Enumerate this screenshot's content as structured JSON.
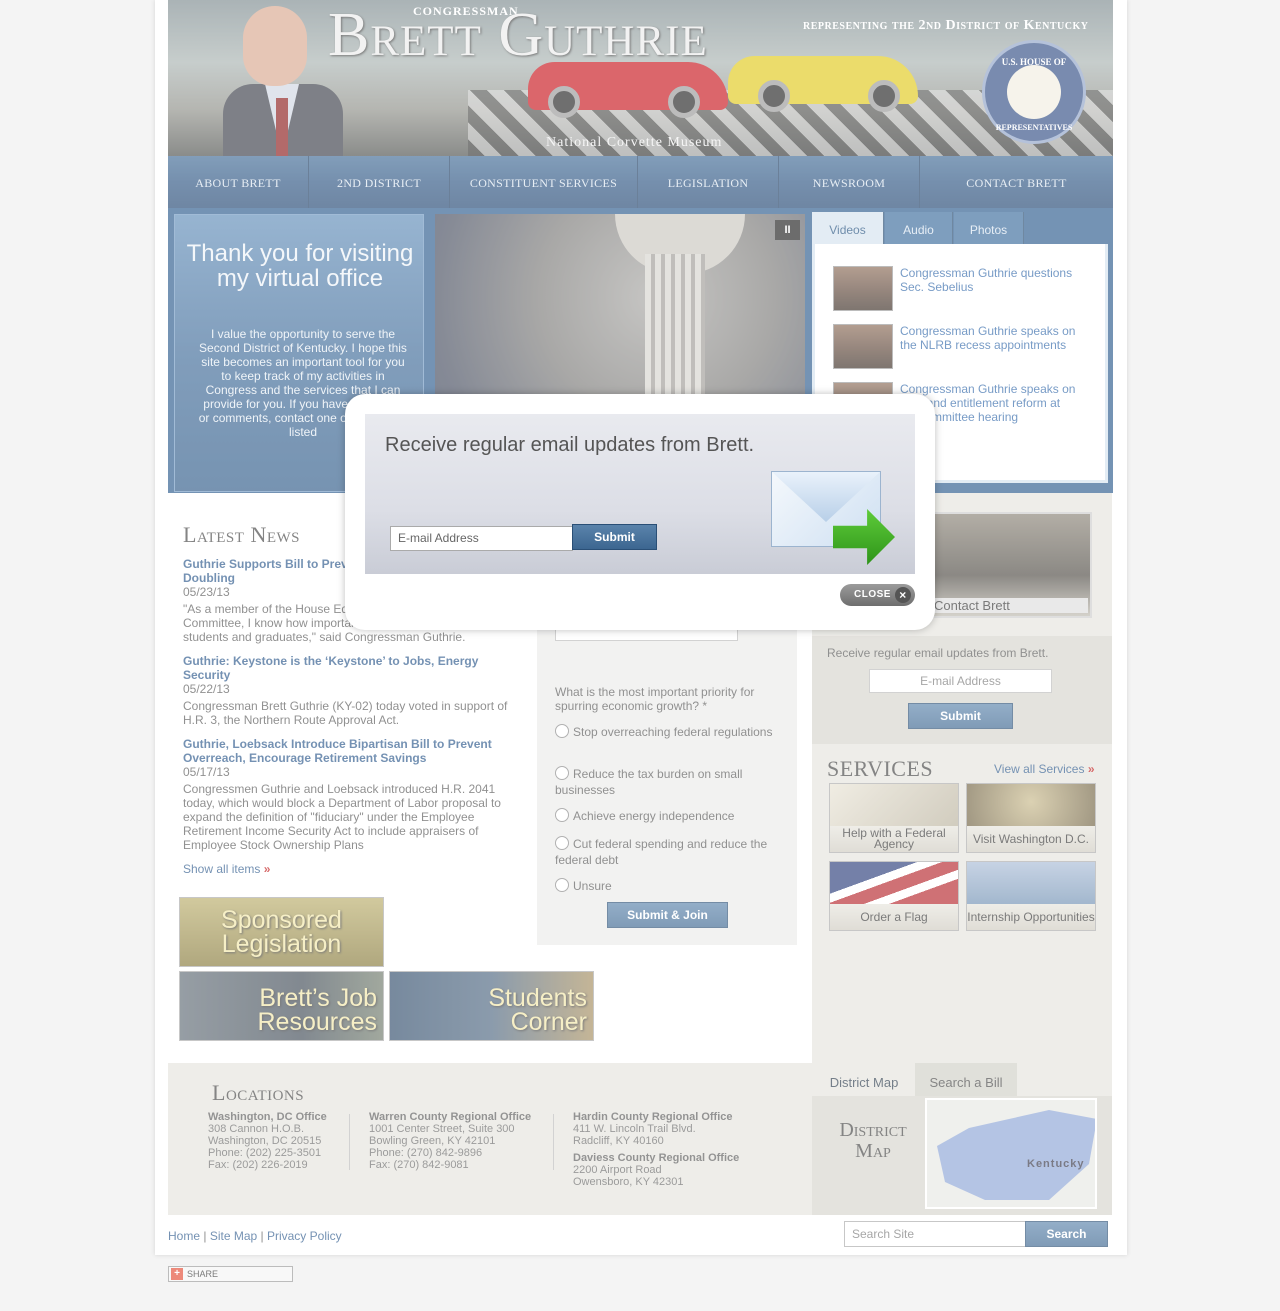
{
  "header": {
    "congressman": "CONGRESSMAN",
    "name": "Brett Guthrie",
    "representing": "representing the 2nd District of Kentucky",
    "caption": "National Corvette Museum",
    "seal_top": "U.S. HOUSE OF",
    "seal_bottom": "REPRESENTATIVES"
  },
  "nav": {
    "items": [
      "ABOUT BRETT",
      "2ND DISTRICT",
      "CONSTITUENT SERVICES",
      "LEGISLATION",
      "NEWSROOM",
      "CONTACT BRETT"
    ]
  },
  "welcome": {
    "title": "Thank you for visiting my virtual office",
    "body": "I value the opportunity to serve the Second District of Kentucky. I hope this site becomes an important tool for you to keep track of my activities in Congress and the services that I can provide for you. If you have questions or comments, contact one of my offices listed"
  },
  "slideshow": {
    "pause_label": "II"
  },
  "media": {
    "tabs": [
      "Videos",
      "Audio",
      "Photos"
    ],
    "videos": [
      "Congressman Guthrie questions Sec. Sebelius",
      "Congressman Guthrie speaks on the NLRB recess appointments",
      "Congressman Guthrie speaks on debt and entitlement reform at subcommittee hearing"
    ]
  },
  "news": {
    "title": "Latest News",
    "items": [
      {
        "title": "Guthrie Supports Bill to Prevent Student Loan Rate Doubling",
        "date": "05/23/13",
        "excerpt": "\"As a member of the House Education and the Workforce Committee, I know how important it is to protect our nation's students and graduates,\" said Congressman Guthrie."
      },
      {
        "title": "Guthrie: Keystone is the ‘Keystone’ to Jobs, Energy Security",
        "date": "05/22/13",
        "excerpt": "Congressman Brett Guthrie (KY-02) today voted in support of H.R. 3, the Northern Route Approval Act."
      },
      {
        "title": "Guthrie, Loebsack Introduce Bipartisan Bill to Prevent Overreach, Encourage Retirement Savings",
        "date": "05/17/13",
        "excerpt": "Congressmen Guthrie and Loebsack introduced H.R. 2041 today, which would block a Department of Labor proposal to expand the definition of \"fiduciary\" under the Employee Retirement Income Security Act to include appraisers of Employee Stock Ownership Plans"
      }
    ],
    "show_all": "Show all items",
    "show_all_arrow": "»"
  },
  "promos": {
    "sponsored": "Sponsored Legislation",
    "jobs": "Brett’s Job Resources",
    "students": "Students Corner"
  },
  "poll": {
    "question": "What is the most important priority for spurring economic growth? *",
    "options": [
      "Stop overreaching federal regulations",
      "Reduce the tax burden on small businesses",
      "Achieve energy independence",
      "Cut federal spending and reduce the federal debt",
      "Unsure"
    ],
    "submit": "Submit & Join"
  },
  "contact_card": {
    "label": "Contact Brett"
  },
  "email_signup": {
    "text": "Receive regular email updates from Brett.",
    "placeholder": "E-mail Address",
    "submit": "Submit"
  },
  "services": {
    "title": "SERVICES",
    "view_all": "View all Services",
    "view_all_arrow": "»",
    "items": [
      "Help with a Federal Agency",
      "Visit Washington D.C.",
      "Order a Flag",
      "Internship Opportunities"
    ]
  },
  "locations": {
    "title": "Locations",
    "offices": [
      {
        "name": "Washington, DC Office",
        "lines": [
          "308 Cannon H.O.B.",
          "Washington, DC 20515",
          "Phone: (202) 225-3501",
          "Fax: (202) 226-2019"
        ]
      },
      {
        "name": "Warren County Regional Office",
        "lines": [
          "1001 Center Street, Suite 300",
          "Bowling Green, KY 42101",
          "Phone: (270) 842-9896",
          "Fax: (270) 842-9081"
        ]
      },
      {
        "name": "Hardin County Regional Office",
        "lines": [
          "411 W. Lincoln Trail Blvd.",
          "Radcliff, KY 40160"
        ]
      },
      {
        "name": "Daviess County Regional Office",
        "lines": [
          "2200 Airport Road",
          "Owensboro, KY 42301"
        ]
      }
    ]
  },
  "district": {
    "tabs": [
      "District Map",
      "Search a Bill"
    ],
    "label": "District Map",
    "map_label": "Kentucky"
  },
  "footer": {
    "links": [
      "Home",
      "Site Map",
      "Privacy Policy"
    ],
    "search_placeholder": "Search Site",
    "search_button": "Search",
    "share": "SHARE"
  },
  "modal": {
    "title": "Receive regular email updates from Brett.",
    "placeholder": "E-mail Address",
    "submit": "Submit",
    "close": "CLOSE",
    "close_icon": "×"
  },
  "colors": {
    "nav_blue": "#2c5482",
    "link_blue": "#2a578a",
    "accent_red": "#c21c1c",
    "panel_beige": "#e5e4dd"
  }
}
